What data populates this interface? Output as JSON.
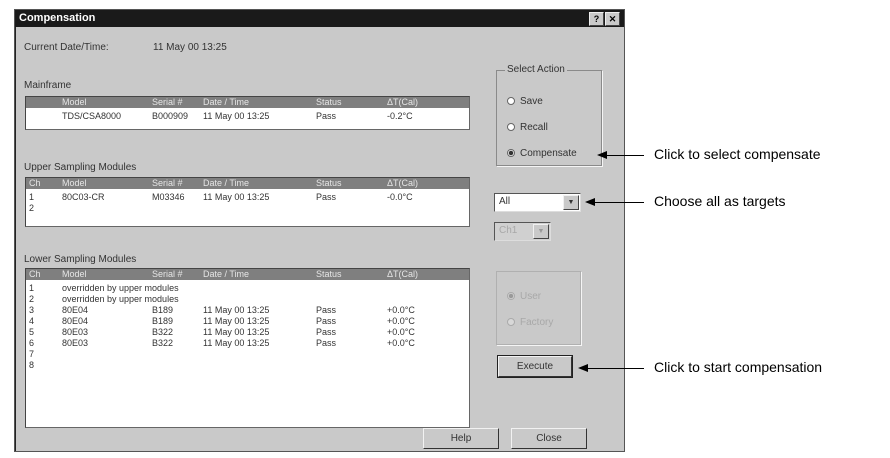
{
  "window": {
    "title": "Compensation",
    "help_glyph": "?",
    "close_glyph": "✕"
  },
  "current_datetime": {
    "label": "Current Date/Time:",
    "value": "11 May 00 13:25"
  },
  "mainframe": {
    "section_label": "Mainframe",
    "columns": [
      "Model",
      "Serial #",
      "Date / Time",
      "Status",
      "ΔT(Cal)"
    ],
    "row": {
      "model": "TDS/CSA8000",
      "serial": "B000909",
      "datetime": "11 May 00 13:25",
      "status": "Pass",
      "delta_t": "-0.2°C"
    }
  },
  "upper_modules": {
    "section_label": "Upper Sampling Modules",
    "columns": [
      "Ch",
      "Model",
      "Serial #",
      "Date / Time",
      "Status",
      "ΔT(Cal)"
    ],
    "rows": [
      {
        "ch": "1",
        "model": "80C03-CR",
        "serial": "M03346",
        "datetime": "11 May 00 13:25",
        "status": "Pass",
        "delta_t": "-0.0°C"
      },
      {
        "ch": "2",
        "model": "",
        "serial": "",
        "datetime": "",
        "status": "",
        "delta_t": ""
      }
    ]
  },
  "lower_modules": {
    "section_label": "Lower Sampling Modules",
    "columns": [
      "Ch",
      "Model",
      "Serial #",
      "Date / Time",
      "Status",
      "ΔT(Cal)"
    ],
    "rows": [
      {
        "ch": "1",
        "model": "overridden by upper modules",
        "serial": "",
        "datetime": "",
        "status": "",
        "delta_t": ""
      },
      {
        "ch": "2",
        "model": "overridden by upper modules",
        "serial": "",
        "datetime": "",
        "status": "",
        "delta_t": ""
      },
      {
        "ch": "3",
        "model": "80E04",
        "serial": "B189",
        "datetime": "11 May 00 13:25",
        "status": "Pass",
        "delta_t": "+0.0°C"
      },
      {
        "ch": "4",
        "model": "80E04",
        "serial": "B189",
        "datetime": "11 May 00 13:25",
        "status": "Pass",
        "delta_t": "+0.0°C"
      },
      {
        "ch": "5",
        "model": "80E03",
        "serial": "B322",
        "datetime": "11 May 00 13:25",
        "status": "Pass",
        "delta_t": "+0.0°C"
      },
      {
        "ch": "6",
        "model": "80E03",
        "serial": "B322",
        "datetime": "11 May 00 13:25",
        "status": "Pass",
        "delta_t": "+0.0°C"
      },
      {
        "ch": "7",
        "model": "",
        "serial": "",
        "datetime": "",
        "status": "",
        "delta_t": ""
      },
      {
        "ch": "8",
        "model": "",
        "serial": "",
        "datetime": "",
        "status": "",
        "delta_t": ""
      }
    ]
  },
  "select_action": {
    "title": "Select Action",
    "options": [
      {
        "label": "Save",
        "selected": false
      },
      {
        "label": "Recall",
        "selected": false
      },
      {
        "label": "Compensate",
        "selected": true
      }
    ]
  },
  "target_select": {
    "value": "All"
  },
  "channel_select": {
    "value": "Ch1"
  },
  "disabled_group": {
    "title": "Mode",
    "options": [
      {
        "label": "User",
        "selected": true
      },
      {
        "label": "Factory",
        "selected": false
      }
    ]
  },
  "buttons": {
    "execute": "Execute",
    "help": "Help",
    "close": "Close"
  },
  "annotations": {
    "compensate": "Click to select compensate",
    "targets": "Choose all as targets",
    "execute": "Click to start compensation"
  }
}
